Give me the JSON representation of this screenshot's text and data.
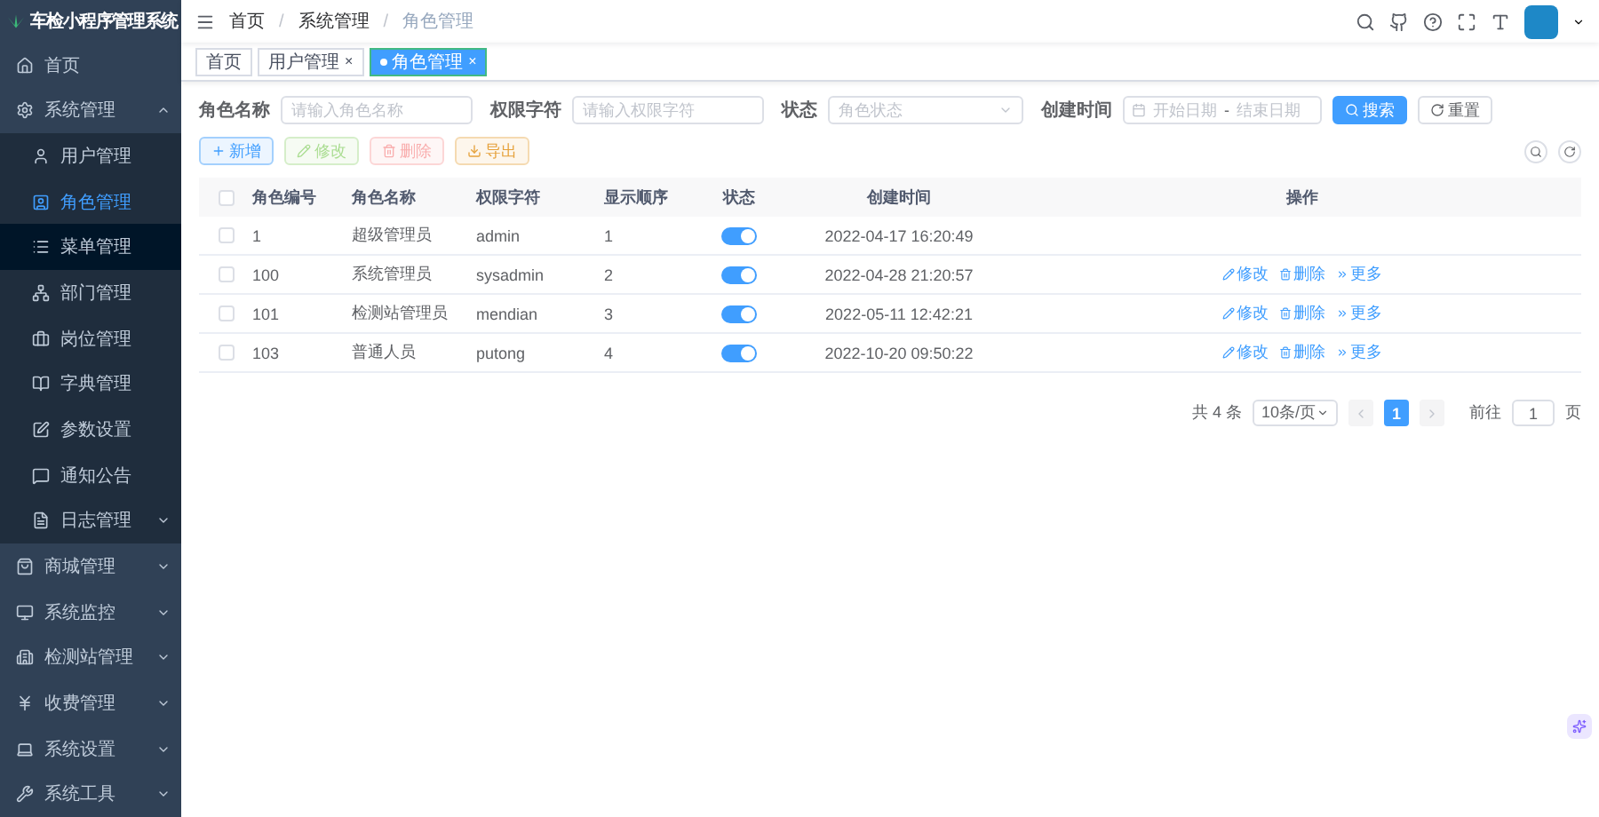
{
  "sidebar": {
    "title": "车检小程序管理系统",
    "items": [
      {
        "label": "首页",
        "selected": false
      },
      {
        "label": "系统管理",
        "selected": false,
        "expanded": true,
        "children": [
          {
            "label": "用户管理",
            "selected": false,
            "hover": false
          },
          {
            "label": "角色管理",
            "selected": true,
            "hover": false
          },
          {
            "label": "菜单管理",
            "selected": false,
            "hover": true
          },
          {
            "label": "部门管理",
            "selected": false,
            "hover": false
          },
          {
            "label": "岗位管理",
            "selected": false,
            "hover": false
          },
          {
            "label": "字典管理",
            "selected": false,
            "hover": false
          },
          {
            "label": "参数设置",
            "selected": false,
            "hover": false
          },
          {
            "label": "通知公告",
            "selected": false,
            "hover": false
          },
          {
            "label": "日志管理",
            "selected": false,
            "hover": false,
            "expanded": false
          }
        ]
      },
      {
        "label": "商城管理",
        "selected": false,
        "expanded": false
      },
      {
        "label": "系统监控",
        "selected": false,
        "expanded": false
      },
      {
        "label": "检测站管理",
        "selected": false,
        "expanded": false
      },
      {
        "label": "收费管理",
        "selected": false,
        "expanded": false
      },
      {
        "label": "系统设置",
        "selected": false,
        "expanded": false
      },
      {
        "label": "系统工具",
        "selected": false,
        "expanded": false
      }
    ]
  },
  "breadcrumb": {
    "separator": "/",
    "items": [
      "首页",
      "系统管理",
      "角色管理"
    ]
  },
  "tags": [
    {
      "label": "首页",
      "selected": false
    },
    {
      "label": "用户管理",
      "selected": false,
      "close": "×"
    },
    {
      "label": "角色管理",
      "selected": true,
      "close": "×"
    }
  ],
  "search_form": {
    "fields": [
      {
        "kind": "input",
        "label": "角色名称",
        "placeholder": "请输入角色名称"
      },
      {
        "kind": "input",
        "label": "权限字符",
        "placeholder": "请输入权限字符"
      },
      {
        "kind": "select",
        "label": "状态",
        "placeholder": "角色状态"
      },
      {
        "kind": "daterange",
        "label": "创建时间",
        "start_placeholder": "开始日期",
        "separator": "-",
        "end_placeholder": "结束日期"
      }
    ],
    "buttons": [
      {
        "kind": "search",
        "label": "搜索"
      },
      {
        "kind": "reset",
        "label": "重置"
      }
    ]
  },
  "toolbar": [
    {
      "kind": "primary",
      "label": "新增",
      "disabled": false
    },
    {
      "kind": "success",
      "label": "修改",
      "disabled": true
    },
    {
      "kind": "danger",
      "label": "删除",
      "disabled": true
    },
    {
      "kind": "warning",
      "label": "导出",
      "disabled": false
    }
  ],
  "table": {
    "columns": [
      "角色编号",
      "角色名称",
      "权限字符",
      "显示顺序",
      "状态",
      "创建时间",
      "操作"
    ],
    "all_checked": false,
    "rows": [
      {
        "checked": false,
        "id": "1",
        "name": "超级管理员",
        "key": "admin",
        "order": "1",
        "on": true,
        "created": "2022-04-17 16:20:49",
        "actions": []
      },
      {
        "checked": false,
        "id": "100",
        "name": "系统管理员",
        "key": "sysadmin",
        "order": "2",
        "on": true,
        "created": "2022-04-28 21:20:57",
        "actions": [
          {
            "kind": "edit",
            "label": "修改"
          },
          {
            "kind": "delete",
            "label": "删除"
          },
          {
            "kind": "more",
            "label": "更多"
          }
        ]
      },
      {
        "checked": false,
        "id": "101",
        "name": "检测站管理员",
        "key": "mendian",
        "order": "3",
        "on": true,
        "created": "2022-05-11 12:42:21",
        "actions": [
          {
            "kind": "edit",
            "label": "修改"
          },
          {
            "kind": "delete",
            "label": "删除"
          },
          {
            "kind": "more",
            "label": "更多"
          }
        ]
      },
      {
        "checked": false,
        "id": "103",
        "name": "普通人员",
        "key": "putong",
        "order": "4",
        "on": true,
        "created": "2022-10-20 09:50:22",
        "actions": [
          {
            "kind": "edit",
            "label": "修改"
          },
          {
            "kind": "delete",
            "label": "删除"
          },
          {
            "kind": "more",
            "label": "更多"
          }
        ]
      }
    ]
  },
  "pagination": {
    "total": "共 4 条",
    "page_size": "10条/页",
    "pages": [
      {
        "label": "1",
        "selected": true
      }
    ],
    "jump_label": "前往",
    "jump_value": "1",
    "jump_suffix": "页"
  }
}
